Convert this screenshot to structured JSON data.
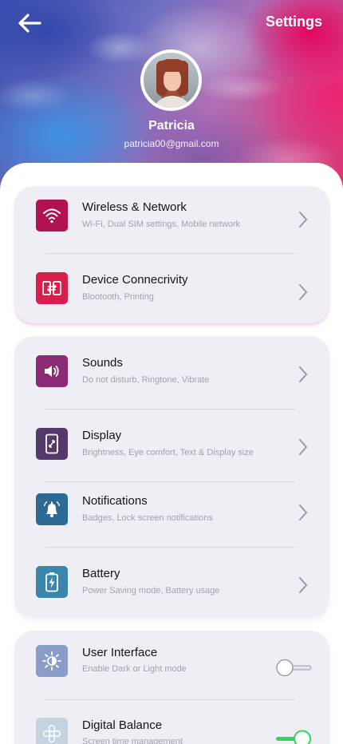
{
  "header": {
    "title": "Settings",
    "back_icon": "arrow-left-icon"
  },
  "profile": {
    "name": "Patricia",
    "email": "patricia00@gmail.com"
  },
  "colors": {
    "accent_toggle": "#2bd95b",
    "card_bg": "#efeef4"
  },
  "groups": [
    {
      "items": [
        {
          "label": "Wireless & Network",
          "sub": "Wi-Fi, Dual SIM settings, Mobile network",
          "icon": "wifi-icon",
          "color": "#b0134f"
        },
        {
          "label": "Device Connecrivity",
          "sub": "Blootooth, Printing",
          "icon": "connectivity-icon",
          "color": "#d81e4b"
        }
      ]
    },
    {
      "items": [
        {
          "label": "Sounds",
          "sub": "Do not disturb, Ringtone, Vibrate",
          "icon": "speaker-icon",
          "color": "#8a2b73"
        },
        {
          "label": "Display",
          "sub": "Brightness, Eye comfort, Text & Display size",
          "icon": "display-icon",
          "color": "#533a6b"
        },
        {
          "label": "Notifications",
          "sub": "Badges, Lock screen notifications",
          "icon": "bell-icon",
          "color": "#2d6a93"
        },
        {
          "label": "Battery",
          "sub": "Power Saving mode, Battery usage",
          "icon": "battery-icon",
          "color": "#3c86ad"
        }
      ]
    },
    {
      "items": [
        {
          "label": "User Interface",
          "sub": "Enable Dark or Light mode",
          "icon": "brightness-icon",
          "color": "#8a9dc9",
          "toggle": false
        },
        {
          "label": "Digital Balance",
          "sub": "Screen time management",
          "icon": "flower-icon",
          "color": "#c5d3e0",
          "toggle": true
        }
      ]
    }
  ]
}
